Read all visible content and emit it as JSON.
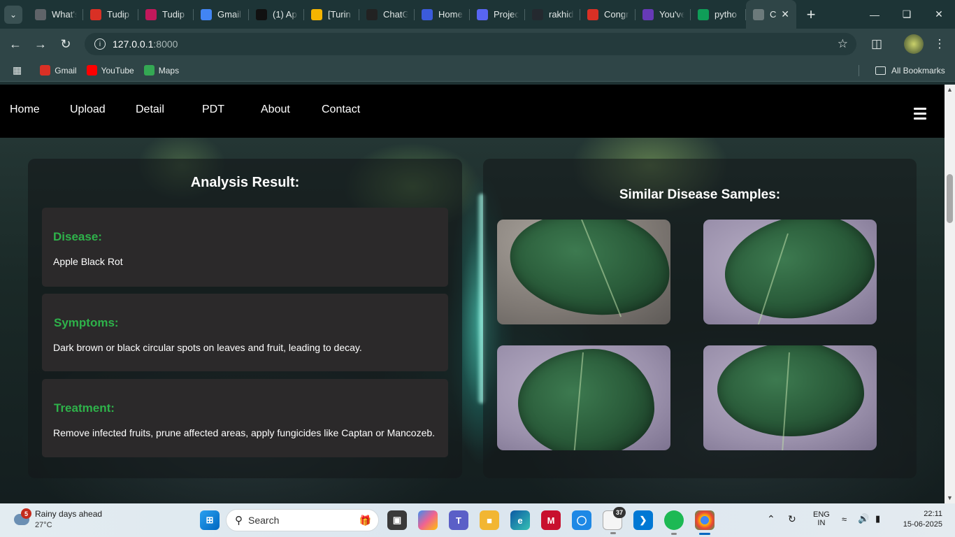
{
  "browser": {
    "tabs": [
      {
        "label": "What's",
        "icon": "chrome-icon",
        "color": "#5f6368"
      },
      {
        "label": "Tudip",
        "icon": "gmail-icon",
        "color": "#d93025"
      },
      {
        "label": "Tudip",
        "icon": "jira-icon",
        "color": "#c2185b"
      },
      {
        "label": "Gmail",
        "icon": "google-icon",
        "color": "#4285f4"
      },
      {
        "label": "(1) Ap",
        "icon": "app-icon",
        "color": "#111111"
      },
      {
        "label": "[Turin",
        "icon": "slides-icon",
        "color": "#f4b400"
      },
      {
        "label": "ChatG",
        "icon": "chatgpt-icon",
        "color": "#222222"
      },
      {
        "label": "Home",
        "icon": "copilot-icon",
        "color": "#3b5bdb"
      },
      {
        "label": "Projec",
        "icon": "project-icon",
        "color": "#5865f2"
      },
      {
        "label": "rakhid",
        "icon": "github-icon",
        "color": "#24292f"
      },
      {
        "label": "Congr",
        "icon": "gmail-icon",
        "color": "#d93025"
      },
      {
        "label": "You've",
        "icon": "forms-icon",
        "color": "#673ab7"
      },
      {
        "label": "pytho",
        "icon": "drive-icon",
        "color": "#0f9d58"
      },
      {
        "label": "C",
        "icon": "loading-icon",
        "color": "#6c7a7b",
        "active": true
      }
    ],
    "url_host": "127.0.0.1",
    "url_port": ":8000",
    "bookmarks": [
      {
        "label": "Gmail",
        "icon": "gmail-icon",
        "color": "#d93025"
      },
      {
        "label": "YouTube",
        "icon": "youtube-icon",
        "color": "#ff0000"
      },
      {
        "label": "Maps",
        "icon": "maps-icon",
        "color": "#34a853"
      }
    ],
    "all_bookmarks": "All Bookmarks"
  },
  "site": {
    "nav": [
      "Home",
      "Upload",
      "Detail",
      "PDT",
      "About",
      "Contact"
    ],
    "analysis_title": "Analysis Result:",
    "similar_title": "Similar Disease Samples:",
    "cards": [
      {
        "heading": "Disease:",
        "text": "Apple Black Rot"
      },
      {
        "heading": "Symptoms:",
        "text": "Dark brown or black circular spots on leaves and fruit, leading to decay."
      },
      {
        "heading": "Treatment:",
        "text": "Remove infected fruits, prune affected areas, apply fungicides like Captan or Mancozeb."
      }
    ],
    "samples": [
      "leaf-sample-image",
      "leaf-sample-image",
      "leaf-sample-image",
      "leaf-sample-image"
    ]
  },
  "taskbar": {
    "weather_title": "Rainy days ahead",
    "weather_temp": "27°C",
    "weather_badge": "5",
    "search_placeholder": "Search",
    "badge_count": "37",
    "lang_line1": "ENG",
    "lang_line2": "IN",
    "time": "22:11",
    "date": "15-06-2025"
  },
  "colors": {
    "accent_green": "#2eb24a",
    "card_bg": "#2b292a",
    "nav_bg": "#000000",
    "browser_chrome": "#2f4547"
  }
}
